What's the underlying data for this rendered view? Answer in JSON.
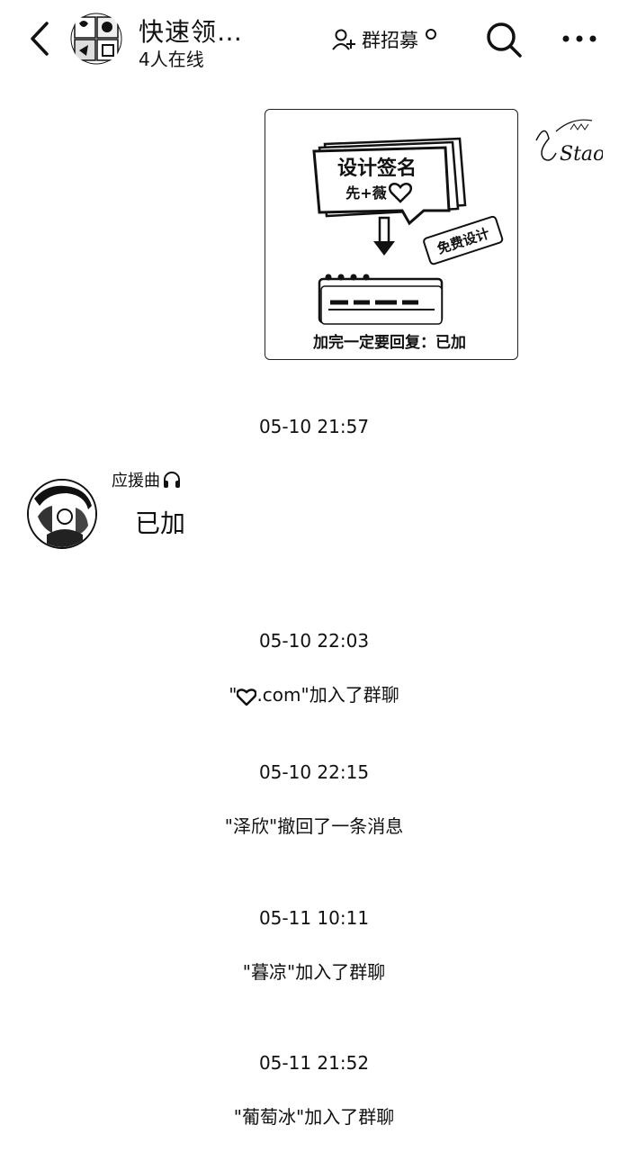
{
  "header": {
    "title": "快速领…",
    "online": "4人在线",
    "recruit_label": "群招募"
  },
  "image_message": {
    "headline": "设计签名",
    "subline": "先+薇",
    "badge": "免费设计",
    "footer": "加完一定要回复：已加",
    "signature_text": "Stao"
  },
  "messages": [
    {
      "time": "05-10 21:57"
    },
    {
      "sender": "应援曲",
      "text": "已加"
    },
    {
      "time": "05-10 22:03"
    },
    {
      "system_before": "\"",
      "system_after": ".com\"加入了群聊"
    },
    {
      "time": "05-10 22:15"
    },
    {
      "system": "\"泽欣\"撤回了一条消息"
    },
    {
      "time": "05-11 10:11"
    },
    {
      "system": "\"暮凉\"加入了群聊"
    },
    {
      "time": "05-11 21:52"
    },
    {
      "system": "\"葡萄冰\"加入了群聊"
    }
  ],
  "icons": [
    "back-arrow-icon",
    "group-avatar",
    "add-user-icon",
    "search-icon",
    "more-icon",
    "headphones-icon",
    "heart-icon"
  ]
}
